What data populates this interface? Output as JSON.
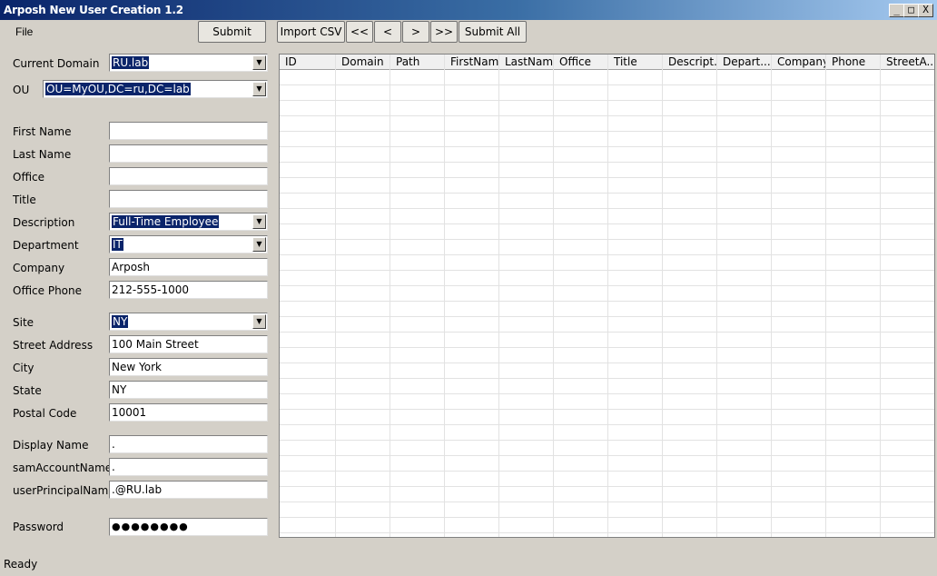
{
  "window": {
    "title": "Arposh New User Creation 1.2",
    "controls": [
      "_",
      "□",
      "X"
    ]
  },
  "menu": {
    "file": "File"
  },
  "toolbar": {
    "submit": "Submit",
    "import_csv": "Import CSV",
    "first": "<<",
    "prev": "<",
    "next": ">",
    "last": ">>",
    "submit_all": "Submit All"
  },
  "form": {
    "current_domain": {
      "label": "Current Domain",
      "value": "RU.lab"
    },
    "ou": {
      "label": "OU",
      "value": "OU=MyOU,DC=ru,DC=lab"
    },
    "first_name": {
      "label": "First Name",
      "value": ""
    },
    "last_name": {
      "label": "Last Name",
      "value": ""
    },
    "office": {
      "label": "Office",
      "value": ""
    },
    "title": {
      "label": "Title",
      "value": ""
    },
    "description": {
      "label": "Description",
      "value": "Full-Time Employee"
    },
    "department": {
      "label": "Department",
      "value": "IT"
    },
    "company": {
      "label": "Company",
      "value": "Arposh"
    },
    "office_phone": {
      "label": "Office Phone",
      "value": "212-555-1000"
    },
    "site": {
      "label": "Site",
      "value": "NY"
    },
    "street_address": {
      "label": "Street Address",
      "value": "100 Main Street"
    },
    "city": {
      "label": "City",
      "value": "New York"
    },
    "state": {
      "label": "State",
      "value": "NY"
    },
    "postal_code": {
      "label": "Postal Code",
      "value": "10001"
    },
    "display_name": {
      "label": "Display Name",
      "value": "."
    },
    "sam_account_name": {
      "label": "samAccountName",
      "value": "."
    },
    "upn": {
      "label": "userPrincipalName",
      "value": ".@RU.lab"
    },
    "password": {
      "label": "Password",
      "value": "●●●●●●●●"
    }
  },
  "grid": {
    "columns": [
      "ID",
      "Domain",
      "Path",
      "FirstName",
      "LastName",
      "Office",
      "Title",
      "Descript...",
      "Depart...",
      "Company",
      "Phone",
      "StreetA..."
    ]
  },
  "status": {
    "text": "Ready"
  }
}
